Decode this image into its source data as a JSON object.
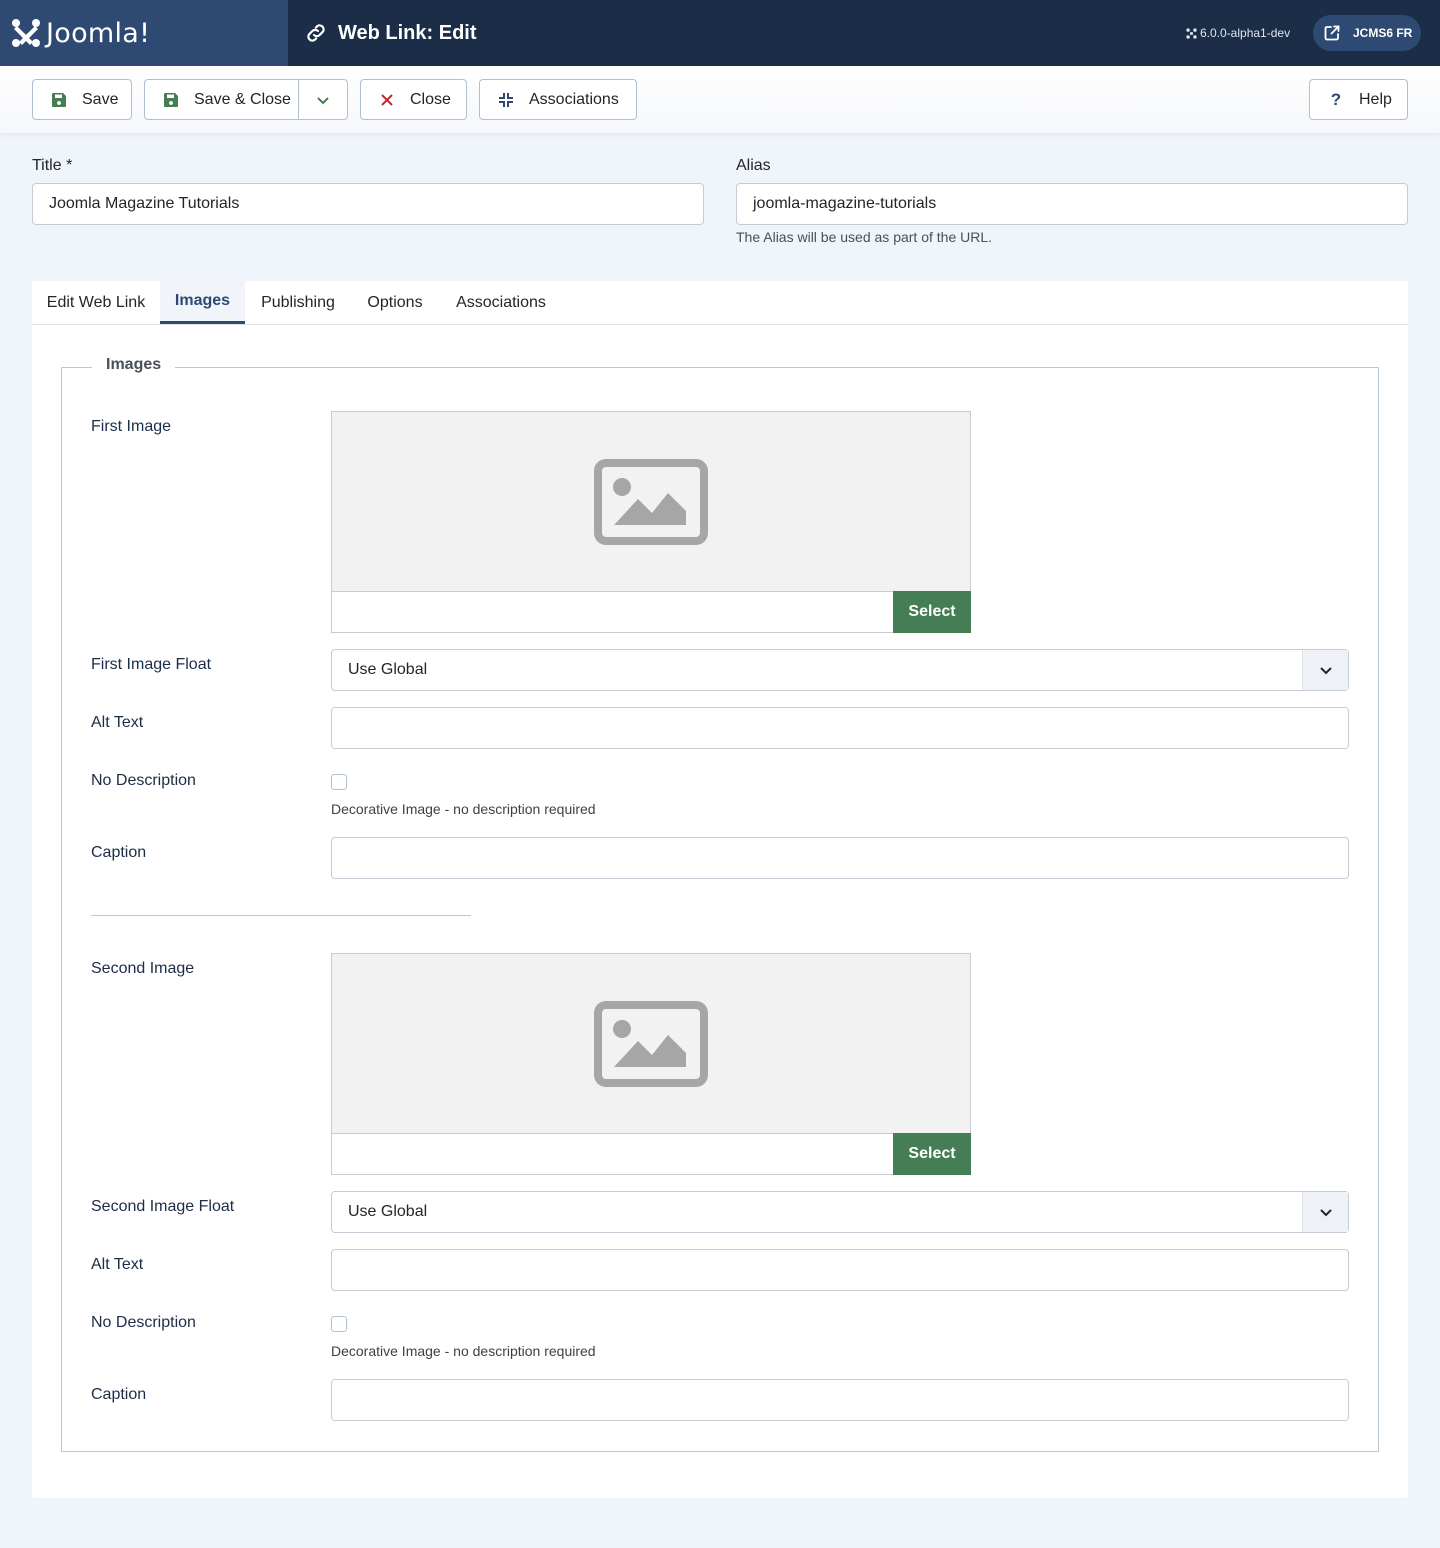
{
  "header": {
    "brand": "Joomla!",
    "page_title": "Web Link: Edit",
    "version": "6.0.0-alpha1-dev",
    "site_label": "JCMS6 FR"
  },
  "toolbar": {
    "save": "Save",
    "save_close": "Save & Close",
    "close": "Close",
    "associations": "Associations",
    "help": "Help"
  },
  "form": {
    "title_label": "Title *",
    "title_value": "Joomla Magazine Tutorials",
    "alias_label": "Alias",
    "alias_value": "joomla-magazine-tutorials",
    "alias_help": "The Alias will be used as part of the URL."
  },
  "tabs": [
    {
      "label": "Edit Web Link",
      "active": false
    },
    {
      "label": "Images",
      "active": true
    },
    {
      "label": "Publishing",
      "active": false
    },
    {
      "label": "Options",
      "active": false
    },
    {
      "label": "Associations",
      "active": false
    }
  ],
  "images": {
    "legend": "Images",
    "first": {
      "label": "First Image",
      "select": "Select",
      "float_label": "First Image Float",
      "float_value": "Use Global",
      "alt_label": "Alt Text",
      "nodesc_label": "No Description",
      "nodesc_help": "Decorative Image - no description required",
      "caption_label": "Caption"
    },
    "second": {
      "label": "Second Image",
      "select": "Select",
      "float_label": "Second Image Float",
      "float_value": "Use Global",
      "alt_label": "Alt Text",
      "nodesc_label": "No Description",
      "nodesc_help": "Decorative Image - no description required",
      "caption_label": "Caption"
    }
  },
  "colors": {
    "header_bg": "#1c2d47",
    "brand_bg": "#2f4a72",
    "success": "#457d54",
    "danger": "#c52827"
  }
}
